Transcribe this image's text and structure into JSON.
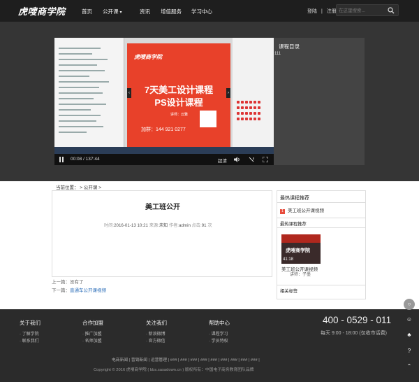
{
  "header": {
    "logo": "虎嗖商学院",
    "nav": [
      {
        "label": "首页"
      },
      {
        "label": "公开课"
      },
      {
        "label": "资讯"
      },
      {
        "label": "增值服务"
      },
      {
        "label": "学习中心"
      }
    ],
    "login": "登陆",
    "sep": "|",
    "register": "注册",
    "search_placeholder": "在这里搜索..."
  },
  "player": {
    "slide_brand": "虎嗖商学院",
    "slide_title_1": "7天美工设计课程",
    "slide_title_2": "PS设计课程",
    "slide_teacher": "讲师：云雅",
    "slide_phone": "加群：144 921 0277",
    "time": "00:08 / 137:44",
    "quality": "超清",
    "progress": 0.001
  },
  "catalog": {
    "title": "课程目录",
    "item": "111"
  },
  "breadcrumb": {
    "text": "当前位置：  >  公开课  >"
  },
  "article": {
    "title": "美工班公开",
    "meta_time_label": "时间:",
    "meta_time": "2016-01-13 10:21",
    "meta_source_label": "来源:",
    "meta_source": "未知",
    "meta_author_label": "作者:",
    "meta_author": "admin",
    "meta_views_label": "点击:",
    "meta_views": "91",
    "meta_views_unit": "次",
    "prev_label": "上一篇：",
    "prev_value": "没有了",
    "next_label": "下一篇：",
    "next_value": "直通车公开课视频"
  },
  "sidebar": {
    "hot_title": "最热课程推荐",
    "hot_items": [
      {
        "num": "1",
        "label": "美工班公开课视频"
      }
    ],
    "recommend_title": "最热课程推荐",
    "thumb_brand": "虎嗖商学院",
    "thumb_duration": "41:18",
    "thumb_title": "美工班公开课视频",
    "thumb_teacher": "讲师：子墨",
    "related_title": "相关标签"
  },
  "footer": {
    "columns": [
      {
        "title": "关于我们",
        "links": [
          "· 了解学院",
          "· 联系我们"
        ]
      },
      {
        "title": "合作加盟",
        "links": [
          "· 推广加盟",
          "· 名师加盟"
        ]
      },
      {
        "title": "关注我们",
        "links": [
          "· 新浪微博",
          "· 官方微信"
        ]
      },
      {
        "title": "帮助中心",
        "links": [
          "· 课程学习",
          "· 学员特权"
        ]
      }
    ],
    "phone": "400 - 0529 - 011",
    "hours": "每天 9:00 - 18:00 (仅收市话费)",
    "links": "电商新闻  |  营销新闻  |  运营管理  |  ###  |  ###  |  ###  |  ###  |  ###  |  ###  |  ###  |  ###  |  ###  |",
    "copyright": "Copyright © 2016 虎嗖商学院 ( bbs.sasadown.cn )     版权所有：中国电子商务教育团队品牌"
  }
}
